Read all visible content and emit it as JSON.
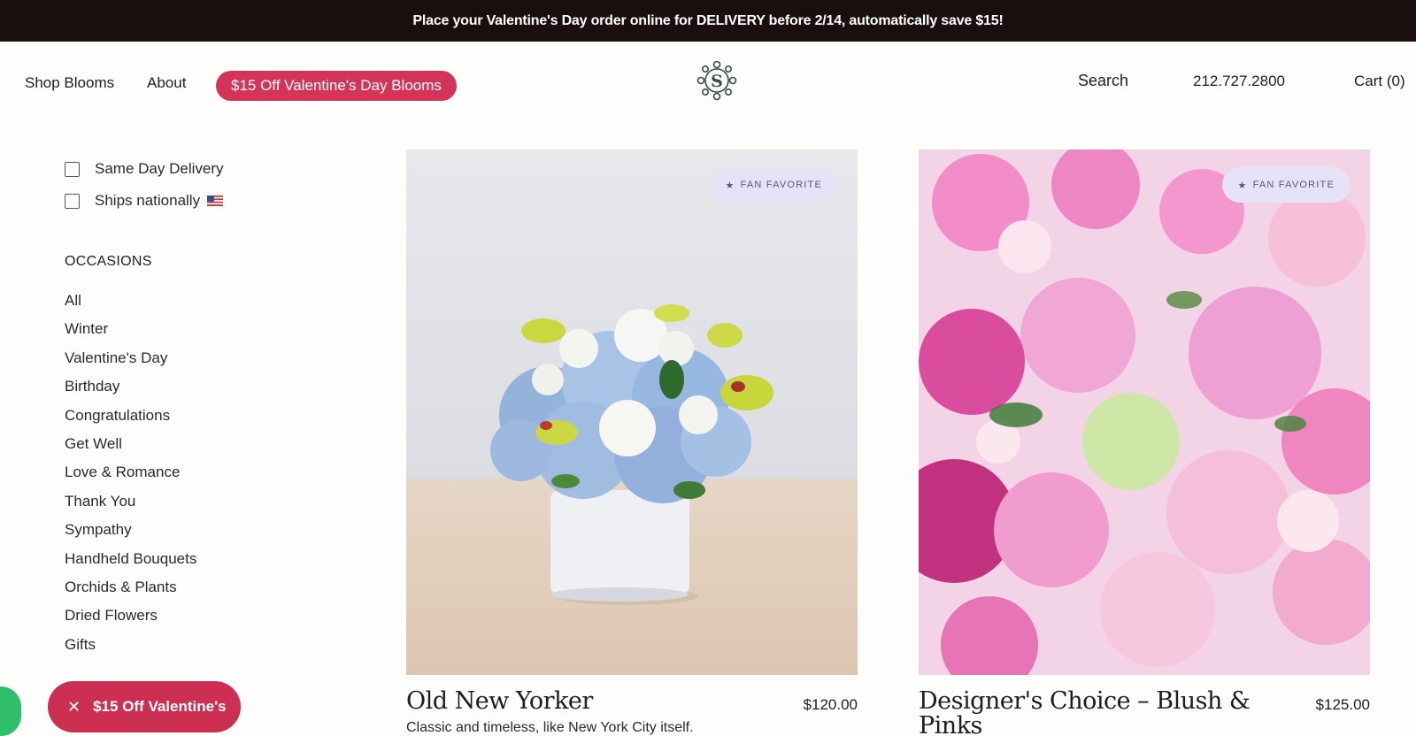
{
  "announcement": "Place your Valentine's Day order online for DELIVERY before 2/14, automatically save $15!",
  "nav": {
    "shop_blooms": "Shop Blooms",
    "about": "About",
    "promo": "$15 Off Valentine's Day Blooms",
    "logo_letter": "S",
    "search": "Search",
    "phone": "212.727.2800",
    "cart": "Cart (0)"
  },
  "filters": {
    "same_day": "Same Day Delivery",
    "ships_nationally": "Ships nationally"
  },
  "occasions": {
    "title": "OCCASIONS",
    "items": [
      "All",
      "Winter",
      "Valentine's Day",
      "Birthday",
      "Congratulations",
      "Get Well",
      "Love & Romance",
      "Thank You",
      "Sympathy",
      "Handheld Bouquets",
      "Orchids & Plants",
      "Dried Flowers",
      "Gifts"
    ]
  },
  "products": [
    {
      "badge": "FAN FAVORITE",
      "title": "Old New Yorker",
      "price": "$120.00",
      "description": "Classic and timeless, like New York City itself."
    },
    {
      "badge": "FAN FAVORITE",
      "title": "Designer's Choice – Blush & Pinks",
      "price": "$125.00",
      "description": ""
    }
  ],
  "floating_promo": {
    "label": "$15 Off Valentine's",
    "close": "✕"
  },
  "colors": {
    "topbar": "#1b0e0e",
    "accent": "#d43458",
    "badge_bg": "#e6e3f6"
  }
}
